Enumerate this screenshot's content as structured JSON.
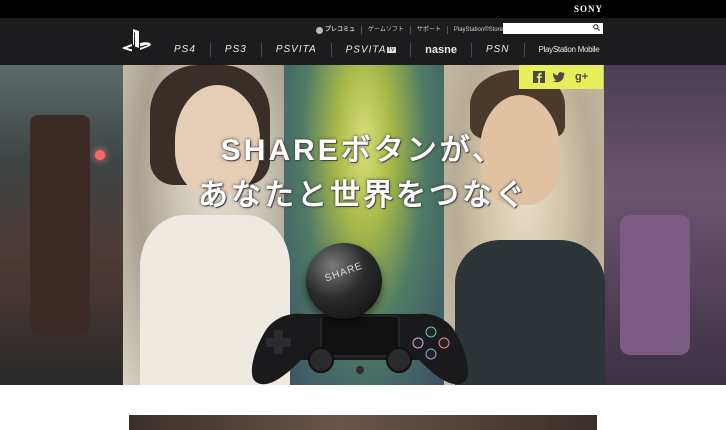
{
  "brand": {
    "sony": "SONY"
  },
  "utility_links": [
    "プレコミュ",
    "ゲームソフト",
    "サポート",
    "PlayStation®Store"
  ],
  "search": {
    "placeholder": ""
  },
  "platforms": [
    "PS4",
    "PS3",
    "PSVITA",
    "PSVITA",
    "nasne",
    "PSN",
    "PlayStation Mobile"
  ],
  "platform_tv_badge": "tv",
  "hero": {
    "line1": "SHAREボタンが、",
    "line2": "あなたと世界をつなぐ",
    "share_button_label": "SHARE"
  },
  "social": {
    "icons": [
      "facebook-icon",
      "twitter-icon",
      "google-plus-icon"
    ],
    "gplus_text": "g+"
  },
  "colors": {
    "topbar": "#000000",
    "nav": "#1c1c1e",
    "social_bg": "#e7f05a"
  }
}
